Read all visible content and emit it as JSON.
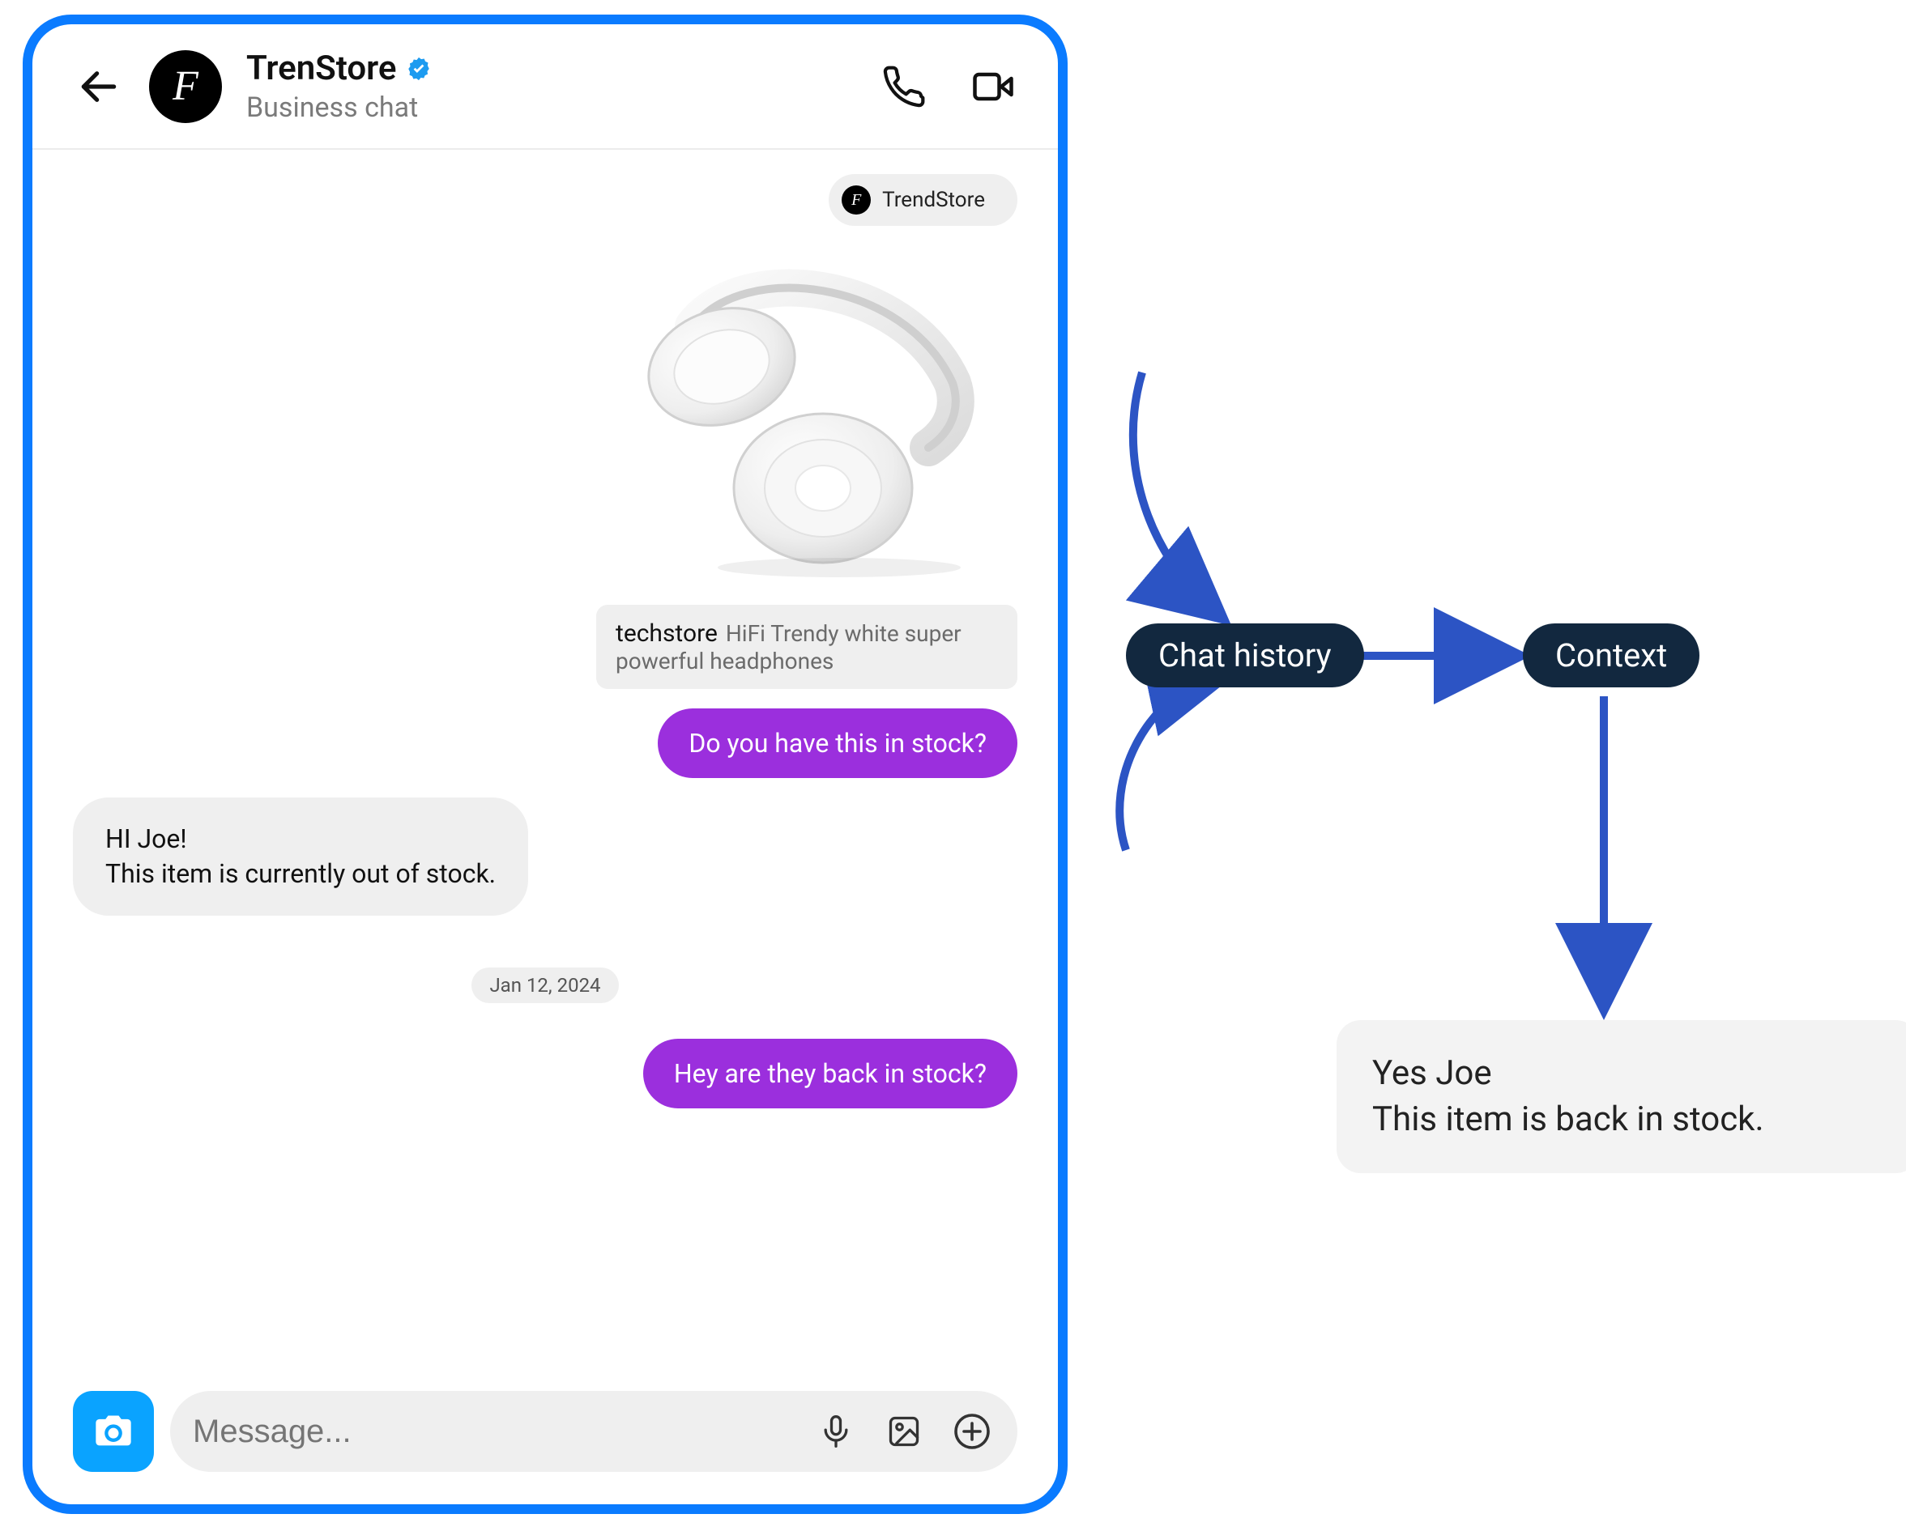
{
  "header": {
    "store_name": "TrenStore",
    "subtitle": "Business chat",
    "avatar_initial": "F"
  },
  "thread": {
    "store_chip_name": "TrendStore",
    "product": {
      "brand": "techstore",
      "description": "HiFi Trendy white super powerful headphones"
    },
    "out1": "Do you have this in stock?",
    "in1_line1": "HI Joe!",
    "in1_line2": "This item is currently out of stock.",
    "date": "Jan 12, 2024",
    "out2": "Hey are they back in stock?"
  },
  "composer": {
    "placeholder": "Message..."
  },
  "diagram": {
    "node_chat_history": "Chat history",
    "node_context": "Context",
    "response_line1": "Yes Joe",
    "response_line2": "This item is back in stock."
  }
}
